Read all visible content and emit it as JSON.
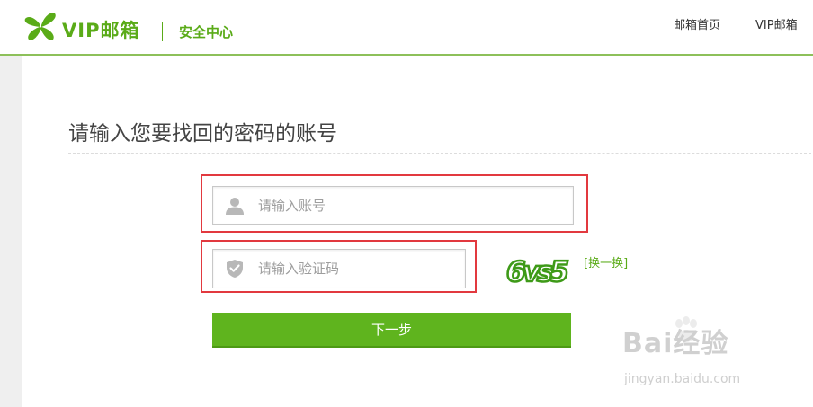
{
  "header": {
    "brand": "VIP邮箱",
    "subtitle": "安全中心",
    "nav": [
      {
        "label": "邮箱首页"
      },
      {
        "label": "VIP邮箱"
      }
    ]
  },
  "main": {
    "title": "请输入您要找回的密码的账号",
    "account_input": {
      "placeholder": "请输入账号",
      "value": ""
    },
    "captcha_input": {
      "placeholder": "请输入验证码",
      "value": ""
    },
    "captcha_image_text": "6vs5",
    "refresh_label": "[换一换]",
    "next_button": "下一步"
  },
  "watermark": {
    "text": "Bai经验",
    "url": "jingyan.baidu.com"
  },
  "colors": {
    "brand_green": "#5aab18",
    "button_green": "#5fb41e",
    "highlight_red": "#e2393f"
  },
  "icons": [
    "clover-logo-icon",
    "user-icon",
    "shield-check-icon",
    "baidu-paw-icon"
  ]
}
